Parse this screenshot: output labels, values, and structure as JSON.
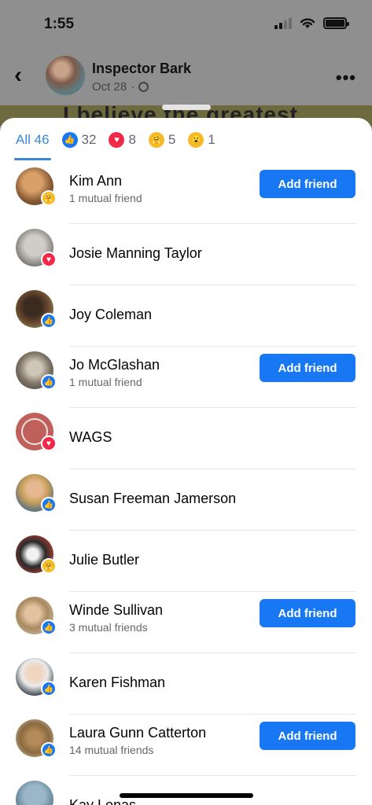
{
  "status_bar": {
    "time": "1:55"
  },
  "post": {
    "page_name": "Inspector Bark",
    "date": "Oct 28",
    "separator": "·",
    "image_caption_text": "I believe the greatest"
  },
  "tabs": [
    {
      "label": "All 46",
      "active": true
    },
    {
      "icon": "like-icon",
      "count": "32"
    },
    {
      "icon": "love-icon",
      "count": "8"
    },
    {
      "icon": "care-icon",
      "count": "5"
    },
    {
      "icon": "wow-icon",
      "count": "1"
    }
  ],
  "people": [
    {
      "name": "Kim Ann",
      "sub": "1 mutual friend",
      "reaction": "care",
      "button": "Add friend"
    },
    {
      "name": "Josie Manning Taylor",
      "reaction": "love"
    },
    {
      "name": "Joy Coleman",
      "reaction": "like"
    },
    {
      "name": "Jo McGlashan",
      "sub": "1 mutual friend",
      "reaction": "like",
      "button": "Add friend"
    },
    {
      "name": "WAGS",
      "reaction": "love"
    },
    {
      "name": "Susan Freeman Jamerson",
      "reaction": "like"
    },
    {
      "name": "Julie Butler",
      "reaction": "care"
    },
    {
      "name": "Winde Sullivan",
      "sub": "3 mutual friends",
      "reaction": "like",
      "button": "Add friend"
    },
    {
      "name": "Karen Fishman",
      "reaction": "like"
    },
    {
      "name": "Laura Gunn Catterton",
      "sub": "14 mutual friends",
      "reaction": "like",
      "button": "Add friend"
    },
    {
      "name": "Kay Lonas"
    }
  ],
  "colors": {
    "accent": "#1877f2",
    "tab_active": "#3a87d6",
    "love": "#f02849",
    "care": "#f7b928"
  }
}
